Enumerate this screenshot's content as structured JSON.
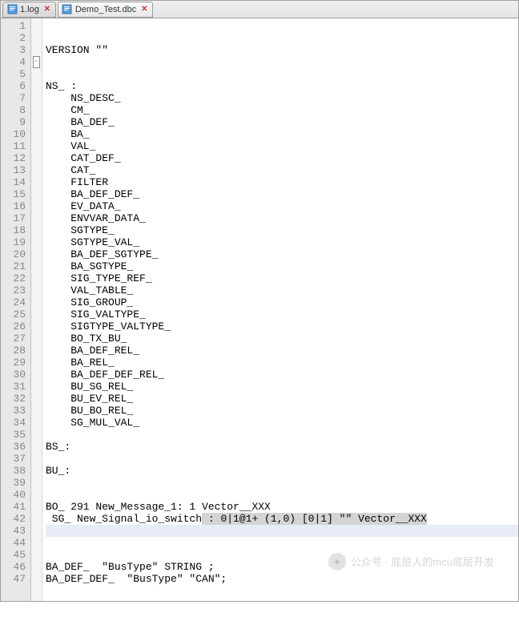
{
  "tabs": [
    {
      "label": "1.log",
      "active": false
    },
    {
      "label": "Demo_Test.dbc",
      "active": true
    }
  ],
  "watermark": "公众号 · 底层人的mcu底层开发",
  "code_lines": [
    "VERSION \"\"",
    "",
    "",
    "NS_ :",
    "    NS_DESC_",
    "    CM_",
    "    BA_DEF_",
    "    BA_",
    "    VAL_",
    "    CAT_DEF_",
    "    CAT_",
    "    FILTER",
    "    BA_DEF_DEF_",
    "    EV_DATA_",
    "    ENVVAR_DATA_",
    "    SGTYPE_",
    "    SGTYPE_VAL_",
    "    BA_DEF_SGTYPE_",
    "    BA_SGTYPE_",
    "    SIG_TYPE_REF_",
    "    VAL_TABLE_",
    "    SIG_GROUP_",
    "    SIG_VALTYPE_",
    "    SIGTYPE_VALTYPE_",
    "    BO_TX_BU_",
    "    BA_DEF_REL_",
    "    BA_REL_",
    "    BA_DEF_DEF_REL_",
    "    BU_SG_REL_",
    "    BU_EV_REL_",
    "    BU_BO_REL_",
    "    SG_MUL_VAL_",
    "",
    "BS_:",
    "",
    "BU_:",
    "",
    "",
    "BO_ 291 New_Message_1: 1 Vector__XXX",
    " SG_ New_Signal_io_switch : 0|1@1+ (1,0) [0|1] \"\" Vector__XXX",
    "",
    "",
    "",
    "BA_DEF_  \"BusType\" STRING ;",
    "BA_DEF_DEF_  \"BusType\" \"CAN\";",
    "",
    ""
  ],
  "selection": {
    "line": 40,
    "prefix": " SG_ New_Signal_io_switch",
    "highlighted": " : 0|1@1+ (1,0) [0|1] \"\" Vector__XXX"
  },
  "current_line": 41
}
